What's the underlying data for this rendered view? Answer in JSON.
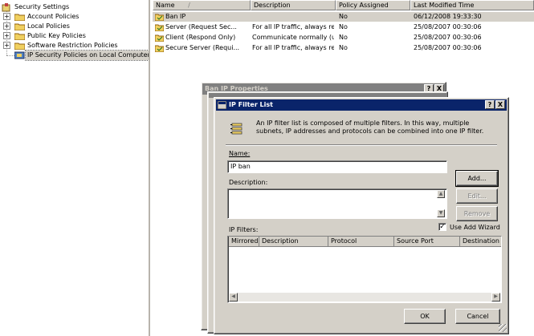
{
  "tree": {
    "root": "Security Settings",
    "items": [
      {
        "label": "Account Policies",
        "expander": "+"
      },
      {
        "label": "Local Policies",
        "expander": "+"
      },
      {
        "label": "Public Key Policies",
        "expander": "+"
      },
      {
        "label": "Software Restriction Policies",
        "expander": "+"
      },
      {
        "label": "IP Security Policies on Local Computer",
        "expander": ""
      }
    ]
  },
  "list": {
    "columns": [
      "Name",
      "Description",
      "Policy Assigned",
      "Last Modified Time"
    ],
    "sort_glyph": "/",
    "rows": [
      {
        "name": "Ban IP",
        "description": "",
        "assigned": "No",
        "modified": "06/12/2008 19:33:30"
      },
      {
        "name": "Server (Request Sec...",
        "description": "For all IP traffic, always req...",
        "assigned": "No",
        "modified": "25/08/2007 00:30:06"
      },
      {
        "name": "Client (Respond Only)",
        "description": "Communicate normally (uns...",
        "assigned": "No",
        "modified": "25/08/2007 00:30:06"
      },
      {
        "name": "Secure Server (Requi...",
        "description": "For all IP traffic, always req...",
        "assigned": "No",
        "modified": "25/08/2007 00:30:06"
      }
    ]
  },
  "back_dialog": {
    "title": "Ban IP Properties"
  },
  "dialog": {
    "title": "IP Filter List",
    "help_btn": "?",
    "close_btn": "X",
    "intro": "An IP filter list is composed of multiple filters. In this way, multiple subnets, IP addresses and protocols can be combined into one IP filter.",
    "name_label": "Name:",
    "name_value": "IP ban",
    "description_label": "Description:",
    "description_value": "",
    "add_label": "Add...",
    "edit_label": "Edit...",
    "remove_label": "Remove",
    "use_wizard_label": "Use Add Wizard",
    "use_wizard_checked": "✓",
    "filters_label": "IP Filters:",
    "filter_columns": [
      "Mirrored",
      "Description",
      "Protocol",
      "Source Port",
      "Destination"
    ],
    "ok_label": "OK",
    "cancel_label": "Cancel"
  },
  "colors": {
    "title_active": "#0a246a",
    "title_inactive": "#808080",
    "face": "#d4d0c8"
  }
}
